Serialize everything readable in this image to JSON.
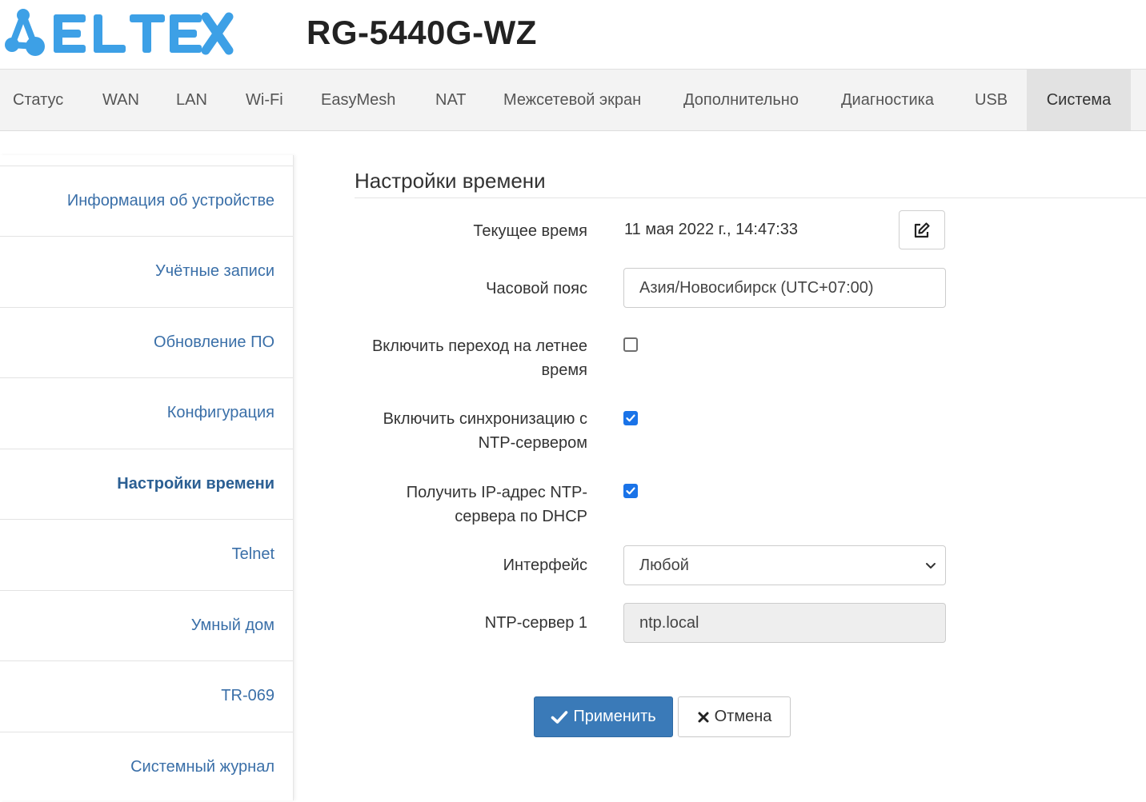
{
  "header": {
    "brand": "ELTEX",
    "model": "RG-5440G-WZ",
    "logo_color": "#3da0e6"
  },
  "topnav": {
    "items": [
      {
        "label": "Статус"
      },
      {
        "label": "WAN"
      },
      {
        "label": "LAN"
      },
      {
        "label": "Wi-Fi"
      },
      {
        "label": "EasyMesh"
      },
      {
        "label": "NAT"
      },
      {
        "label": "Межсетевой экран"
      },
      {
        "label": "Дополнительно"
      },
      {
        "label": "Диагностика"
      },
      {
        "label": "USB"
      },
      {
        "label": "Система",
        "active": true
      }
    ]
  },
  "sidebar": {
    "items": [
      {
        "label": "Информация об устройстве"
      },
      {
        "label": "Учётные записи"
      },
      {
        "label": "Обновление ПО"
      },
      {
        "label": "Конфигурация"
      },
      {
        "label": "Настройки времени",
        "active": true
      },
      {
        "label": "Telnet"
      },
      {
        "label": "Умный дом"
      },
      {
        "label": "TR-069"
      },
      {
        "label": "Системный журнал"
      }
    ]
  },
  "main": {
    "title": "Настройки времени",
    "current_time": {
      "label": "Текущее время",
      "value": "11 мая 2022 г., 14:47:33",
      "edit_icon": "edit-icon"
    },
    "timezone": {
      "label": "Часовой пояс",
      "value": "Азия/Новосибирск (UTC+07:00)"
    },
    "dst": {
      "label_line1": "Включить переход на летнее",
      "label_line2": "время",
      "checked": false
    },
    "ntp_sync": {
      "label_line1": "Включить синхронизацию с",
      "label_line2": "NTP-сервером",
      "checked": true
    },
    "ntp_dhcp": {
      "label_line1": "Получить IP-адрес NTP-",
      "label_line2": "сервера по DHCP",
      "checked": true
    },
    "interface": {
      "label": "Интерфейс",
      "value": "Любой"
    },
    "ntp_server_1": {
      "label": "NTP-сервер 1",
      "value": "ntp.local",
      "disabled": true
    }
  },
  "actions": {
    "apply_label": "Применить",
    "cancel_label": "Отмена",
    "apply_color": "#3a7ab8"
  }
}
